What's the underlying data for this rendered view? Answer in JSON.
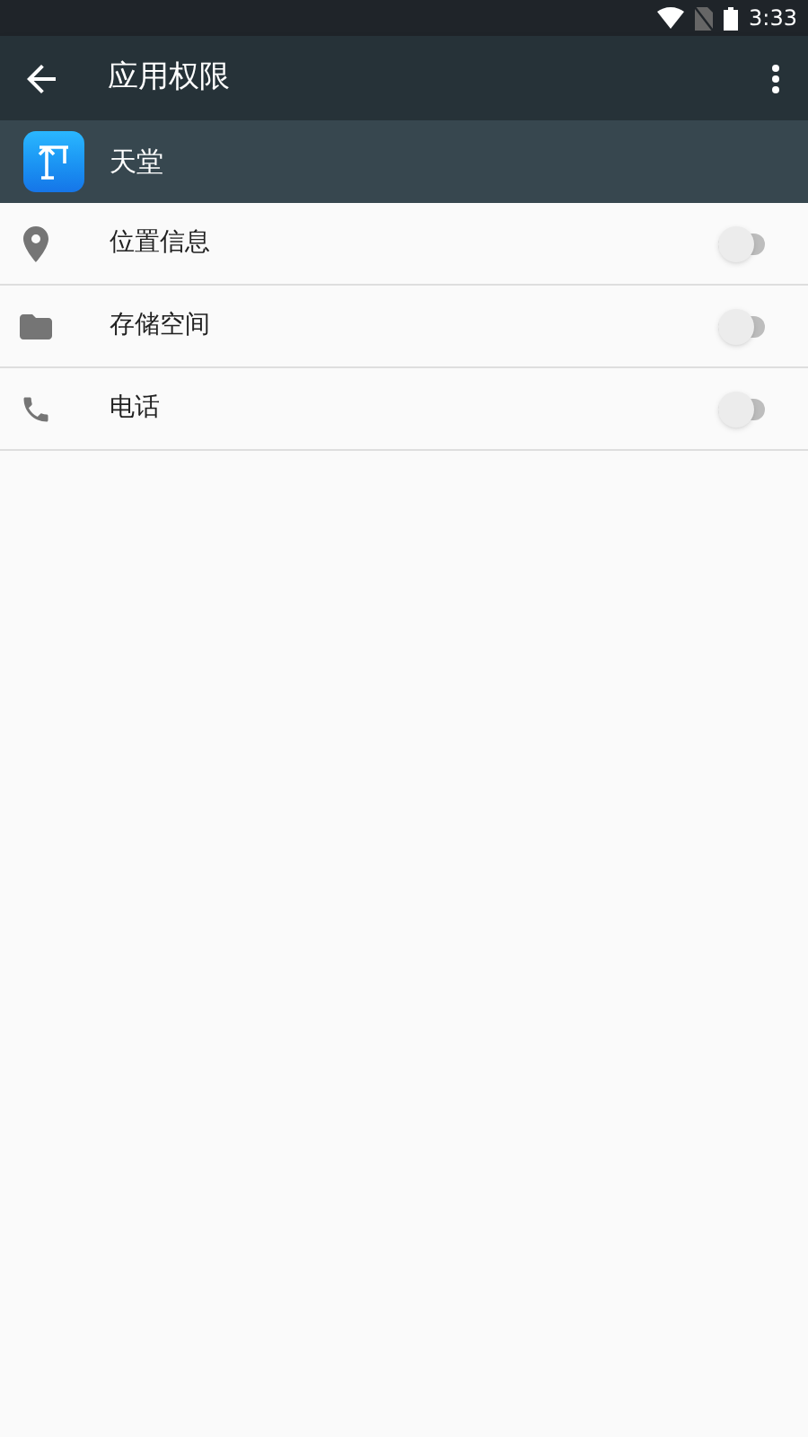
{
  "status_bar": {
    "time": "3:33"
  },
  "toolbar": {
    "title": "应用权限"
  },
  "app": {
    "name": "天堂"
  },
  "permissions": [
    {
      "kind": "location",
      "label": "位置信息",
      "on": false
    },
    {
      "kind": "storage",
      "label": "存储空间",
      "on": false
    },
    {
      "kind": "phone",
      "label": "电话",
      "on": false
    }
  ]
}
